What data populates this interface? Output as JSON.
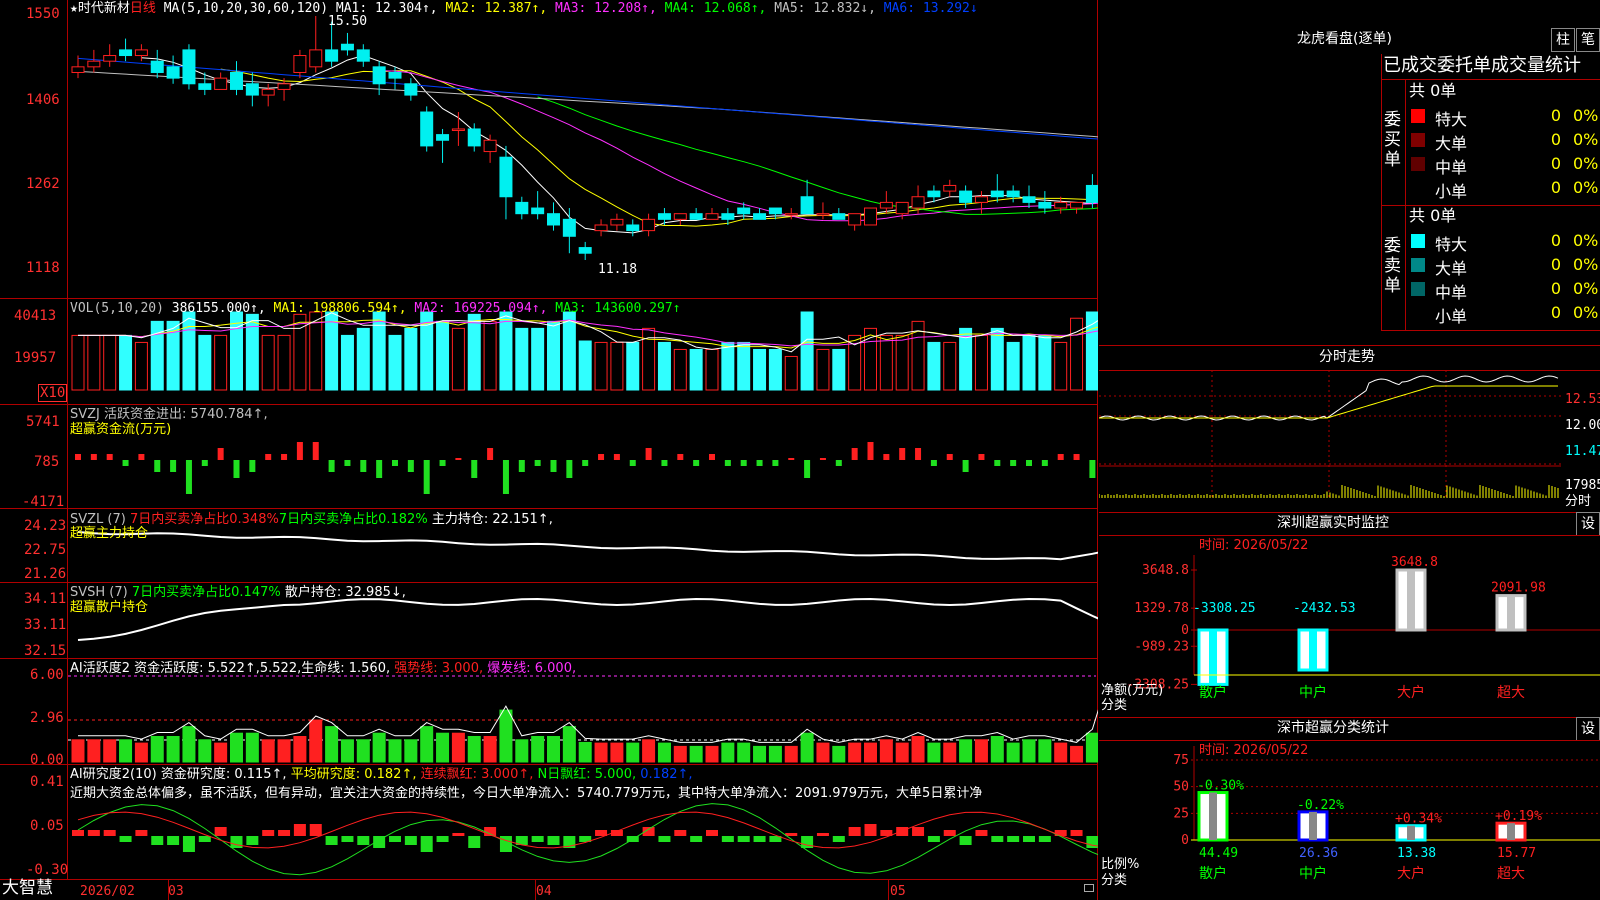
{
  "colors": {
    "up": "#ff2020",
    "down": "#00f0f0",
    "vol_down": "#30ffff",
    "net_pos": "#ff2020",
    "net_neg": "#20e020",
    "ma1": "#ffffff",
    "ma2": "#ffff00",
    "ma3": "#ff30ff",
    "ma4": "#00ff00",
    "ma5": "#c0c0c0",
    "ma6": "#0040ff",
    "frame": "#b00000"
  },
  "kline": {
    "title_star": "★",
    "stock_name": "时代新材",
    "period": "日线",
    "ma_params": "MA(5,10,20,30,60,120)",
    "ma1_label": "MA1: 12.304↑,",
    "ma2_label": "MA2: 12.387↑,",
    "ma3_label": "MA3: 12.208↑,",
    "ma4_label": "MA4: 12.068↑,",
    "ma5_label": "MA5: 12.832↓,",
    "ma6_label": "MA6: 13.292↓",
    "high_label": "15.50",
    "low_label": "11.18",
    "y_labels": [
      "1550",
      "1406",
      "1262",
      "1118"
    ]
  },
  "vol": {
    "title": "VOL(5,10,20)",
    "value": "386155.000↑,",
    "ma1": "MA1: 198806.594↑,",
    "ma2": "MA2: 169225.094↑,",
    "ma3": "MA3: 143600.297↑",
    "y_labels": [
      "40413",
      "19957"
    ],
    "unit": "X10"
  },
  "svzj": {
    "title": "SVZJ  活跃资金进出: 5740.784↑,",
    "sub": "超赢资金流(万元)",
    "y_labels": [
      "5741",
      "785",
      "-4171"
    ]
  },
  "svzl": {
    "title_a": "SVZL (7)",
    "title_b": "7日内买卖净占比0.348%",
    "title_c": "7日内买卖净占比0.182%",
    "title_d": "主力持仓: 22.151↑,",
    "sub": "超赢主力持仓",
    "y_labels": [
      "24.23",
      "22.75",
      "21.26"
    ]
  },
  "svsh": {
    "title_a": "SVSH (7)",
    "title_b": "7日内买卖净占比0.147%",
    "title_c": "散户持仓: 32.985↓,",
    "sub": "超赢散户持仓",
    "y_labels": [
      "34.11",
      "33.11",
      "32.15"
    ]
  },
  "ai1": {
    "title": "AI活跃度2 资金活跃度: 5.522↑,5.522,生命线: 1.560,",
    "strong": "强势线: 3.000,",
    "burst": "爆发线: 6.000,",
    "y_labels": [
      "6.00",
      "2.96",
      "0.00"
    ]
  },
  "ai2": {
    "title_a": "AI研究度2(10) 资金研究度: 0.115↑,",
    "title_b": "平均研究度: 0.182↑,",
    "title_c": "连续飘红: 3.000↑,",
    "title_d": "N日飘红: 5.000,",
    "title_e": "0.182↑,",
    "comment": "近期大资金总体偏多，虽不活跃，但有异动，宜关注大资金的持续性，今日大单净流入：5740.779万元，其中特大单净流入：2091.979万元，大单5日累计净",
    "y_labels": [
      "0.41",
      "0.05",
      "-0.30"
    ]
  },
  "xaxis": {
    "brand": "大智慧",
    "dates": [
      "2026/02",
      "03",
      "04",
      "05"
    ]
  },
  "longhu": {
    "title": "龙虎看盘(逐单)",
    "btn1": "柱",
    "btn2": "笔",
    "header": "已成交委托单成交量统计",
    "buy": {
      "side_label": "委买单",
      "total": "共 0单",
      "rows": [
        {
          "name": "特大",
          "n": "0",
          "p": "0%"
        },
        {
          "name": "大单",
          "n": "0",
          "p": "0%"
        },
        {
          "name": "中单",
          "n": "0",
          "p": "0%"
        },
        {
          "name": "小单",
          "n": "0",
          "p": "0%"
        }
      ]
    },
    "sell": {
      "side_label": "委卖单",
      "total": "共 0单",
      "rows": [
        {
          "name": "特大",
          "n": "0",
          "p": "0%"
        },
        {
          "name": "大单",
          "n": "0",
          "p": "0%"
        },
        {
          "name": "中单",
          "n": "0",
          "p": "0%"
        },
        {
          "name": "小单",
          "n": "0",
          "p": "0%"
        }
      ]
    }
  },
  "fenshi": {
    "title": "分时走势",
    "y_labels": [
      "12.53",
      "12.00",
      "11.47",
      "17985"
    ],
    "unit": "分时"
  },
  "sz_monitor": {
    "title": "深圳超赢实时监控",
    "btn": "设",
    "time": "时间: 2026/05/22",
    "y_labels": [
      "3648.8",
      "1329.78",
      "0",
      "-989.23",
      "-3308.25"
    ],
    "unit": "净额(万元)",
    "unit2": "分类",
    "bars": [
      {
        "cat": "散户",
        "value": -3308.25,
        "label": "-3308.25"
      },
      {
        "cat": "中户",
        "value": -2432.53,
        "label": "-2432.53"
      },
      {
        "cat": "大户",
        "value": 3648.8,
        "label": "3648.8"
      },
      {
        "cat": "超大",
        "value": 2091.98,
        "label": "2091.98"
      }
    ]
  },
  "sz_class": {
    "title": "深市超赢分类统计",
    "btn": "设",
    "time": "时间: 2026/05/22",
    "y_labels": [
      "75",
      "50",
      "25",
      "0"
    ],
    "unit": "比例%",
    "unit2": "分类",
    "bars": [
      {
        "cat": "散户",
        "value": 44.49,
        "label": "44.49",
        "delta": "-0.30%"
      },
      {
        "cat": "中户",
        "value": 26.36,
        "label": "26.36",
        "delta": "-0.22%"
      },
      {
        "cat": "大户",
        "value": 13.38,
        "label": "13.38",
        "delta": "+0.34%"
      },
      {
        "cat": "超大",
        "value": 15.77,
        "label": "15.77",
        "delta": "+0.19%"
      }
    ]
  },
  "chart_data": [
    {
      "type": "candlestick",
      "title": "时代新材 日线",
      "ylim": [
        11.18,
        15.5
      ],
      "ohlc": [
        [
          14.5,
          14.8,
          14.4,
          14.6
        ],
        [
          14.6,
          14.9,
          14.5,
          14.7
        ],
        [
          14.7,
          15.0,
          14.6,
          14.8
        ],
        [
          14.9,
          15.1,
          14.7,
          14.8
        ],
        [
          14.8,
          15.0,
          14.7,
          14.9
        ],
        [
          14.7,
          14.9,
          14.4,
          14.5
        ],
        [
          14.6,
          14.8,
          14.3,
          14.4
        ],
        [
          14.9,
          15.0,
          14.2,
          14.3
        ],
        [
          14.3,
          14.5,
          14.1,
          14.2
        ],
        [
          14.2,
          14.5,
          14.2,
          14.4
        ],
        [
          14.5,
          14.7,
          14.1,
          14.2
        ],
        [
          14.3,
          14.5,
          13.9,
          14.1
        ],
        [
          14.1,
          14.3,
          13.9,
          14.2
        ],
        [
          14.2,
          14.4,
          14.0,
          14.3
        ],
        [
          14.5,
          14.9,
          14.4,
          14.8
        ],
        [
          14.6,
          15.5,
          14.5,
          14.9
        ],
        [
          14.9,
          15.4,
          14.6,
          14.7
        ],
        [
          15.0,
          15.2,
          14.8,
          14.9
        ],
        [
          14.9,
          15.0,
          14.6,
          14.7
        ],
        [
          14.6,
          14.7,
          14.1,
          14.3
        ],
        [
          14.5,
          14.6,
          14.2,
          14.4
        ],
        [
          14.3,
          14.4,
          14.0,
          14.1
        ],
        [
          13.8,
          13.9,
          13.1,
          13.2
        ],
        [
          13.4,
          13.5,
          12.9,
          13.3
        ],
        [
          13.5,
          13.8,
          13.2,
          13.5
        ],
        [
          13.5,
          13.6,
          13.1,
          13.2
        ],
        [
          13.1,
          13.4,
          12.9,
          13.3
        ],
        [
          13.0,
          13.2,
          11.9,
          12.3
        ],
        [
          12.2,
          12.3,
          11.9,
          12.0
        ],
        [
          12.1,
          12.4,
          11.9,
          12.0
        ],
        [
          12.0,
          12.2,
          11.7,
          11.8
        ],
        [
          11.9,
          12.1,
          11.3,
          11.6
        ],
        [
          11.4,
          11.5,
          11.18,
          11.3
        ],
        [
          11.7,
          11.9,
          11.6,
          11.8
        ],
        [
          11.8,
          12.0,
          11.7,
          11.9
        ],
        [
          11.8,
          11.9,
          11.6,
          11.7
        ],
        [
          11.7,
          12.0,
          11.6,
          11.9
        ],
        [
          12.0,
          12.1,
          11.8,
          11.9
        ],
        [
          11.9,
          12.0,
          11.8,
          12.0
        ],
        [
          12.0,
          12.1,
          11.9,
          11.9
        ],
        [
          11.9,
          12.1,
          11.9,
          12.0
        ],
        [
          12.0,
          12.1,
          11.8,
          11.9
        ],
        [
          12.1,
          12.2,
          11.9,
          12.0
        ],
        [
          12.0,
          12.1,
          11.9,
          11.9
        ],
        [
          12.1,
          12.1,
          11.9,
          12.0
        ],
        [
          12.0,
          12.1,
          11.9,
          12.0
        ],
        [
          12.3,
          12.6,
          12.0,
          12.0
        ],
        [
          12.0,
          12.2,
          11.9,
          12.0
        ],
        [
          12.0,
          12.1,
          11.9,
          11.9
        ],
        [
          11.8,
          12.0,
          11.7,
          12.0
        ],
        [
          11.8,
          12.1,
          11.8,
          12.1
        ],
        [
          12.1,
          12.4,
          12.0,
          12.2
        ],
        [
          12.0,
          12.2,
          11.9,
          12.2
        ],
        [
          12.1,
          12.5,
          12.0,
          12.3
        ],
        [
          12.4,
          12.5,
          12.2,
          12.3
        ],
        [
          12.4,
          12.6,
          12.3,
          12.5
        ],
        [
          12.4,
          12.5,
          12.1,
          12.2
        ],
        [
          12.2,
          12.4,
          12.0,
          12.3
        ],
        [
          12.4,
          12.7,
          12.2,
          12.3
        ],
        [
          12.4,
          12.5,
          12.2,
          12.3
        ],
        [
          12.3,
          12.5,
          12.1,
          12.2
        ],
        [
          12.2,
          12.4,
          12.0,
          12.1
        ],
        [
          12.1,
          12.3,
          12.0,
          12.2
        ],
        [
          12.1,
          12.2,
          12.0,
          12.2
        ],
        [
          12.5,
          12.7,
          12.1,
          12.2
        ],
        [
          12.2,
          12.8,
          12.0,
          12.6
        ]
      ]
    },
    {
      "type": "bar",
      "title": "深圳超赢实时监控",
      "categories": [
        "散户",
        "中户",
        "大户",
        "超大"
      ],
      "values": [
        -3308.25,
        -2432.53,
        3648.8,
        2091.98
      ],
      "ylabel": "净额(万元)",
      "ylim": [
        -3308.25,
        3648.8
      ]
    },
    {
      "type": "bar",
      "title": "深市超赢分类统计",
      "categories": [
        "散户",
        "中户",
        "大户",
        "超大"
      ],
      "values": [
        44.49,
        26.36,
        13.38,
        15.77
      ],
      "ylabel": "比例%",
      "ylim": [
        0,
        75
      ]
    }
  ]
}
